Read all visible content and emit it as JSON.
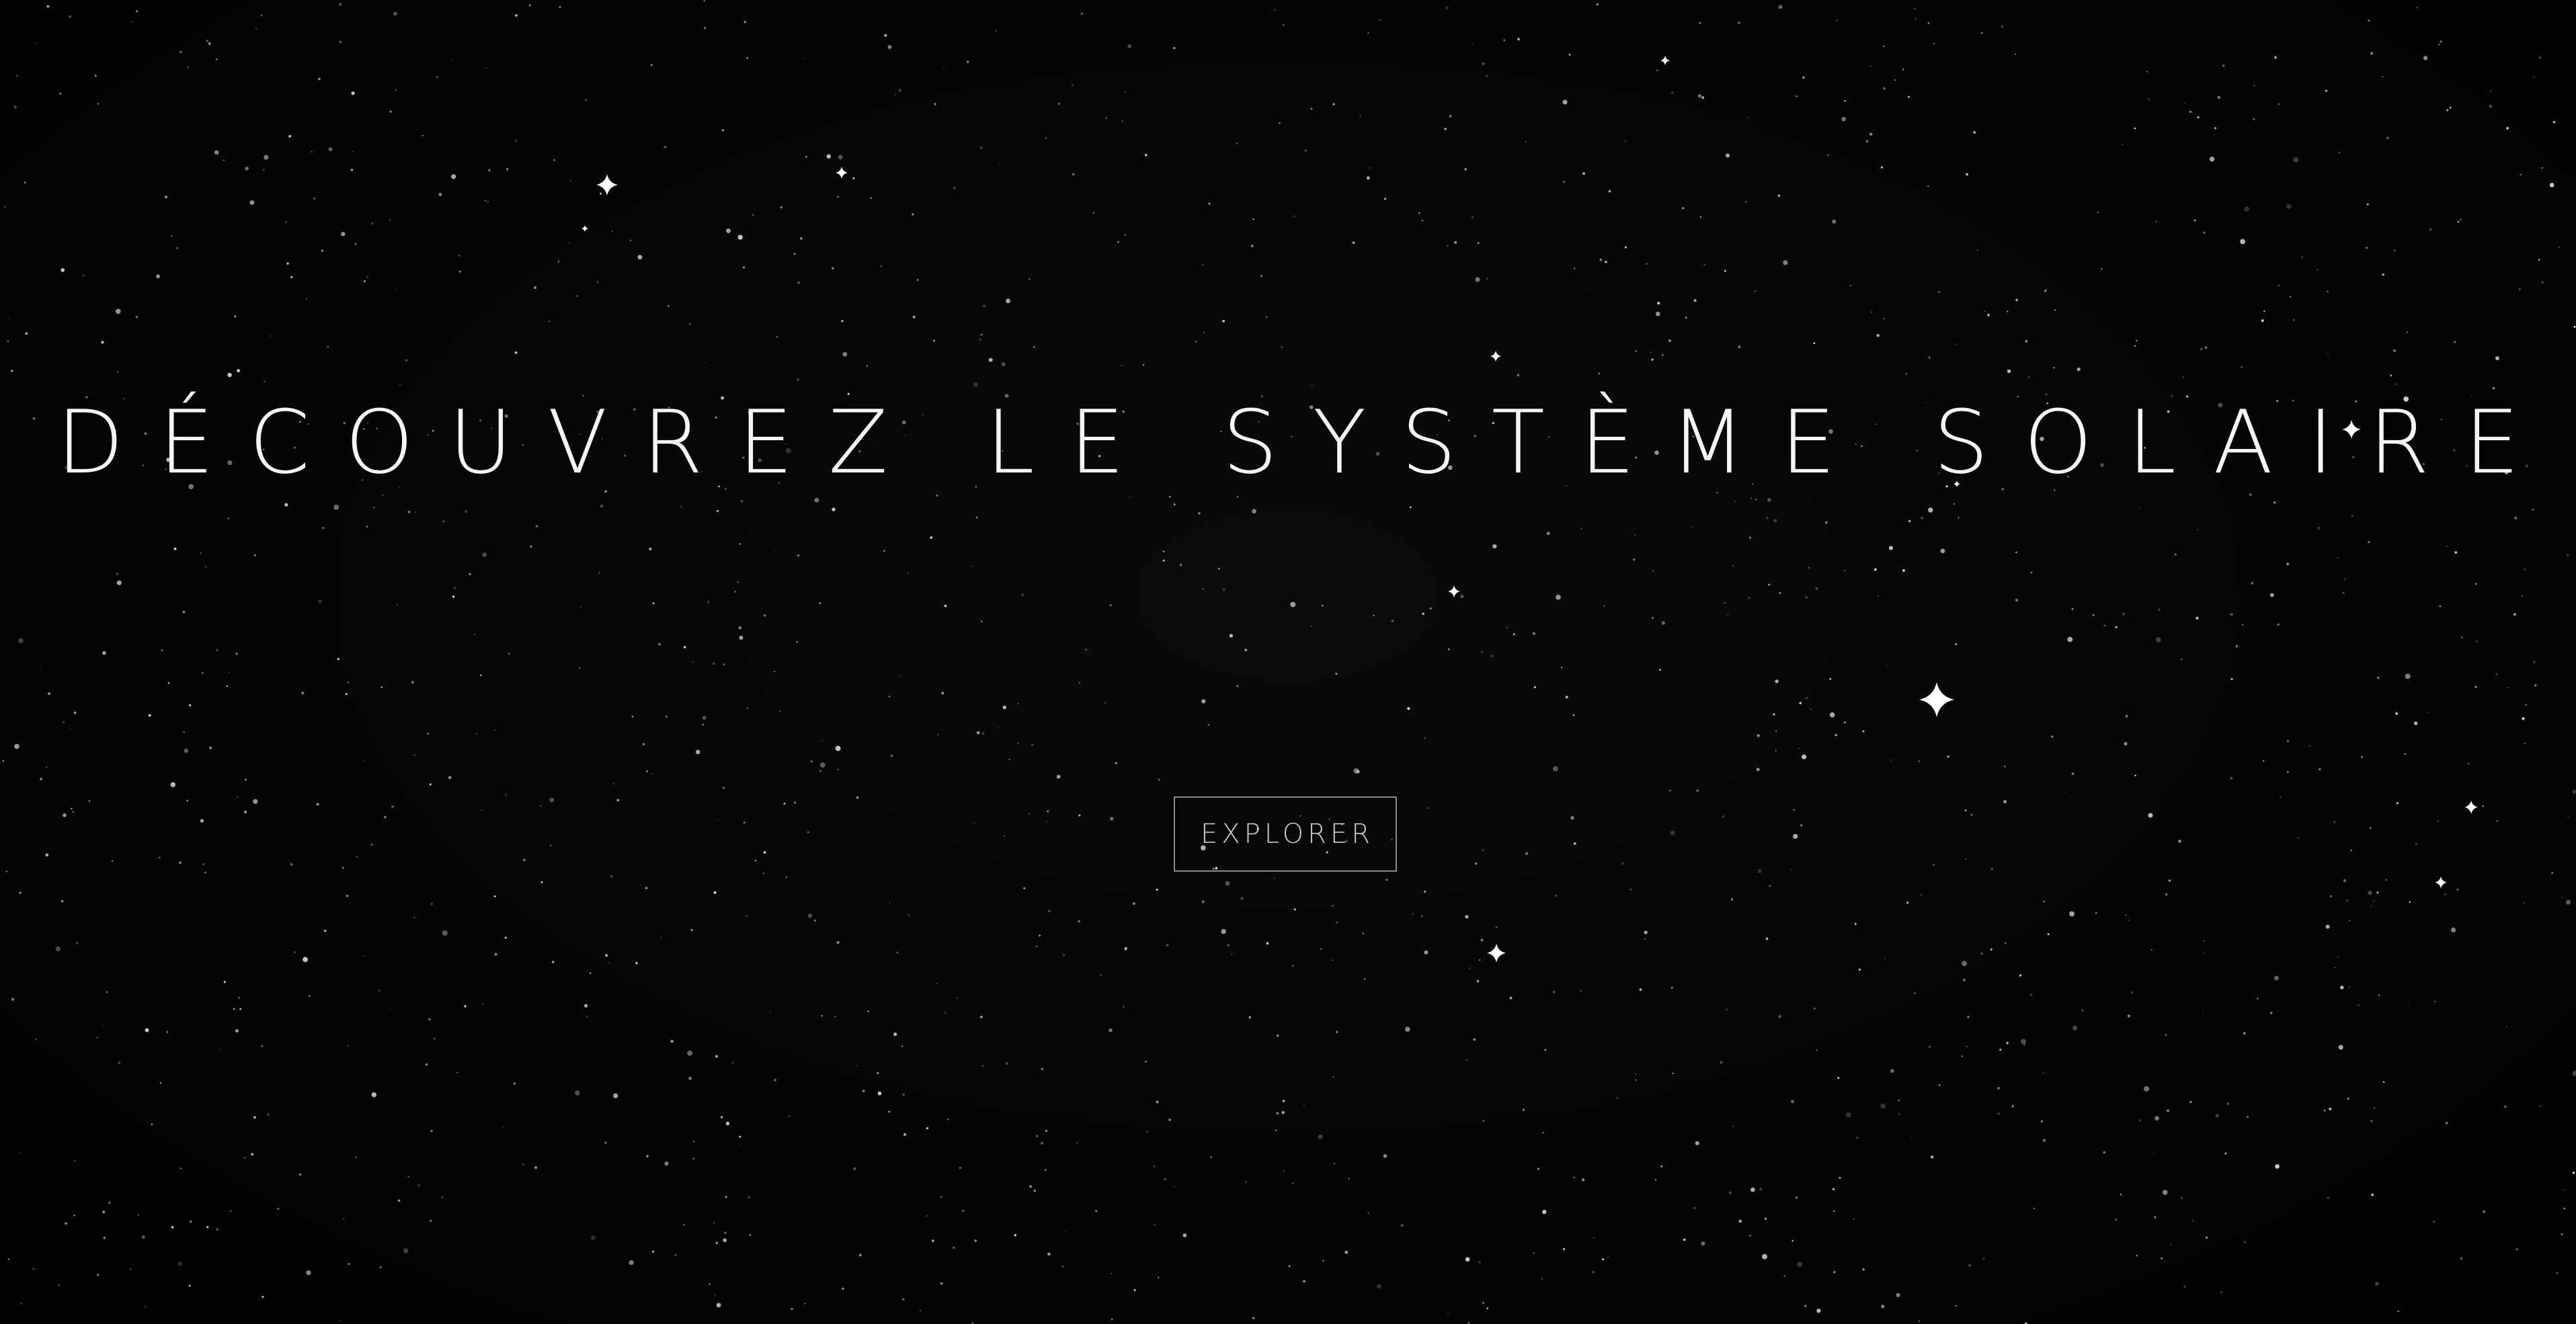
{
  "hero": {
    "title": "DÉCOUVREZ LE SYSTÈME SOLAIRE",
    "explore_label": "EXPLORER"
  },
  "theme": {
    "background": "#050505",
    "text": "#ffffff",
    "button_border": "#8a8a8a",
    "button_text": "#c9c9c9",
    "star": "#ffffff"
  }
}
